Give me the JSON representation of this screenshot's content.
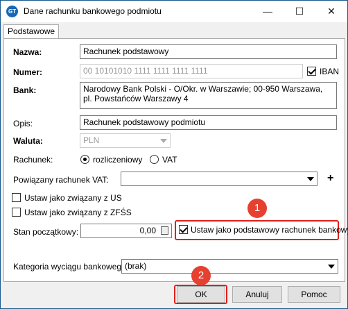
{
  "window": {
    "title": "Dane rachunku bankowego podmiotu",
    "icon": "app-logo-icon",
    "minimize": "—",
    "maximize": "☐",
    "close": "✕"
  },
  "tabs": [
    {
      "label": "Podstawowe",
      "selected": true
    }
  ],
  "form": {
    "nazwa_label": "Nazwa:",
    "nazwa_value": "Rachunek podstawowy",
    "numer_label": "Numer:",
    "numer_value": "00 10101010 1111 1111 1111 1111",
    "iban_label": "IBAN",
    "iban_checked": true,
    "bank_label": "Bank:",
    "bank_value": "Narodowy Bank Polski  - O/Okr. w Warszawie; 00-950 Warszawa, pl. Powstańców Warszawy 4",
    "opis_label": "Opis:",
    "opis_value": "Rachunek podstawowy podmiotu",
    "waluta_label": "Waluta:",
    "waluta_value": "PLN",
    "rachunek_label": "Rachunek:",
    "rachunek_options": [
      "rozliczeniowy",
      "VAT"
    ],
    "rachunek_selected": "rozliczeniowy",
    "powiazany_label": "Powiązany rachunek VAT:",
    "powiazany_value": "",
    "add_glyph": "+",
    "ustaw_us_label": "Ustaw jako związany z US",
    "ustaw_zfss_label": "Ustaw jako związany z ZFŚS",
    "stan_label": "Stan początkowy:",
    "stan_value": "0,00",
    "domyslny_label": "Ustaw jako podstawowy rachunek bankowy",
    "domyslny_checked": true,
    "kategoria_label": "Kategoria wyciągu bankowego:",
    "kategoria_value": "(brak)"
  },
  "buttons": {
    "ok": "OK",
    "anuluj": "Anuluj",
    "pomoc": "Pomoc"
  },
  "annotations": {
    "badge1": "1",
    "badge2": "2",
    "highlight_color": "#e0201b",
    "badge_color": "#e64030"
  }
}
